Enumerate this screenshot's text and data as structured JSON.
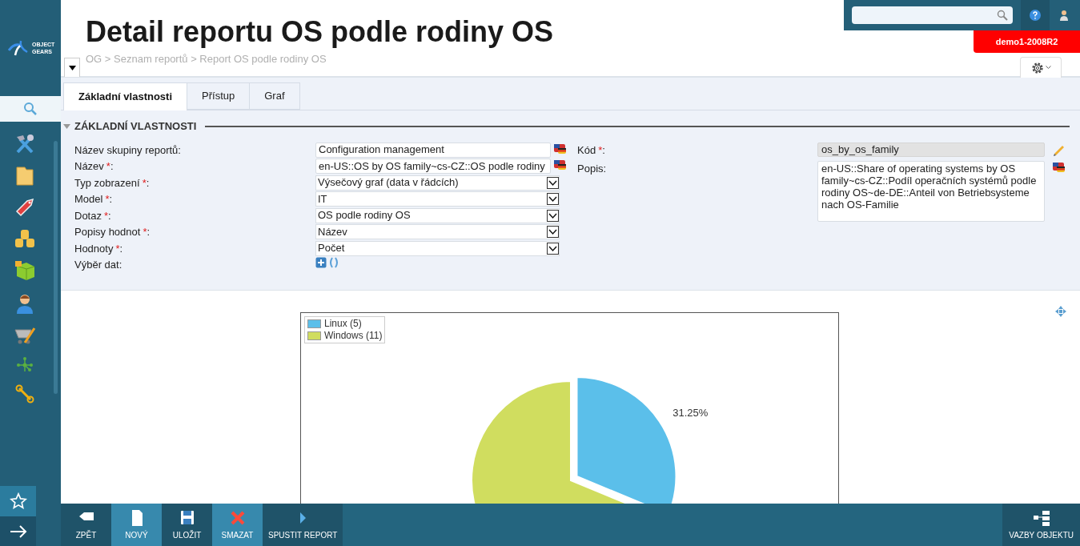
{
  "sidebar": {
    "logo_lines": [
      "OBJECT",
      "GEARS"
    ]
  },
  "header": {
    "title": "Detail reportu OS podle rodiny OS",
    "breadcrumb": "OG > Seznam reportů > Report OS podle rodiny OS",
    "server_badge": "demo1-2008R2"
  },
  "tabs": [
    {
      "label": "Základní vlastnosti",
      "selected": true
    },
    {
      "label": "Přístup",
      "selected": false
    },
    {
      "label": "Graf",
      "selected": false
    }
  ],
  "section": {
    "title": "ZÁKLADNÍ VLASTNOSTI",
    "expanded": true
  },
  "left_fields": [
    {
      "label": "Název skupiny reportů",
      "suffix": ":",
      "kind": "text",
      "value": "Configuration management",
      "translatable": true
    },
    {
      "label": "Název",
      "mark": "*",
      "suffix": ":",
      "kind": "text",
      "value": "en-US::OS by OS family~cs-CZ::OS podle rodiny",
      "translatable": true
    },
    {
      "label": "Typ zobrazení",
      "mark": "*",
      "suffix": ":",
      "kind": "select",
      "value": "Výsečový graf (data v řádcích)"
    },
    {
      "label": "Model",
      "mark": "*",
      "suffix": ":",
      "kind": "select",
      "value": "IT"
    },
    {
      "label": "Dotaz",
      "mark": "*",
      "suffix": ":",
      "kind": "select",
      "value": "OS podle rodiny OS"
    },
    {
      "label": "Popisy hodnot",
      "mark": "*",
      "suffix": ":",
      "kind": "select",
      "value": "Název"
    },
    {
      "label": "Hodnoty",
      "mark": "*",
      "suffix": ":",
      "kind": "select",
      "value": "Počet"
    },
    {
      "label": "Výběr dat",
      "suffix": ":",
      "kind": "actions"
    }
  ],
  "right_fields": [
    {
      "label": "Kód",
      "mark": "*",
      "suffix": ":",
      "kind": "readonly",
      "value": "os_by_os_family"
    },
    {
      "label": "Popis",
      "suffix": ":",
      "kind": "textarea",
      "value": "en-US::Share of operating systems by OS family~cs-CZ::Podíl operačních systémů podle rodiny OS~de-DE::Anteil von Betriebsysteme nach OS-Familie",
      "translatable": true
    }
  ],
  "chart_data": {
    "type": "pie",
    "categories": [
      "Linux (5)",
      "Windows (11)"
    ],
    "values": [
      31.25,
      68.75
    ],
    "legend": "top-left",
    "colors": [
      "#5bbfea",
      "#d0dd5f"
    ],
    "value_labels": [
      "31.25%",
      null
    ]
  },
  "toolbar": [
    {
      "label": "ZPĚT",
      "kind": "back",
      "highlighted": false
    },
    {
      "label": "NOVÝ",
      "kind": "new",
      "highlighted": true
    },
    {
      "label": "ULOŽIT",
      "kind": "save",
      "highlighted": false
    },
    {
      "label": "SMAZAT",
      "kind": "delete",
      "highlighted": true
    },
    {
      "label": "SPUSTIT REPORT",
      "kind": "run",
      "highlighted": false
    }
  ],
  "toolbar_right": {
    "label": "VAZBY OBJEKTU"
  }
}
